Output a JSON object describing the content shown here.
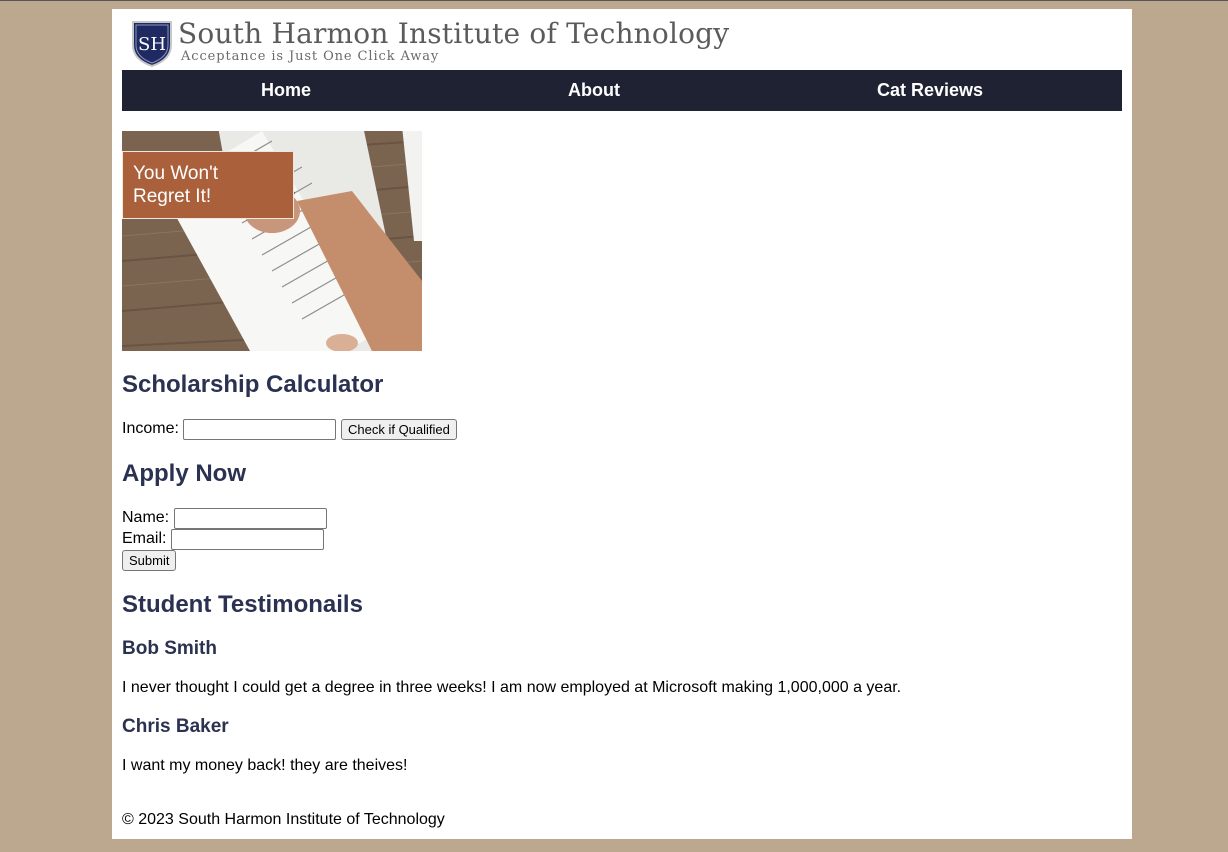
{
  "header": {
    "title": "South Harmon Institute of Technology",
    "tagline": "Acceptance is Just One Click Away",
    "logo_icon": "shield-logo-icon",
    "logo_letters": "SH"
  },
  "nav": {
    "items": [
      {
        "label": "Home"
      },
      {
        "label": "About"
      },
      {
        "label": "Cat Reviews"
      }
    ]
  },
  "hero": {
    "caption_line1": "You Won't",
    "caption_line2": "Regret It!",
    "image_subject": "hand-signing-document-image"
  },
  "scholarship": {
    "heading": "Scholarship Calculator",
    "income_label": "Income:",
    "income_value": "",
    "button_label": "Check if Qualified"
  },
  "apply": {
    "heading": "Apply Now",
    "name_label": "Name:",
    "name_value": "",
    "email_label": "Email:",
    "email_value": "",
    "submit_label": "Submit"
  },
  "testimonials": {
    "heading": "Student Testimonails",
    "items": [
      {
        "name": "Bob Smith",
        "text": "I never thought I could get a degree in three weeks! I am now employed at Microsoft making 1,000,000 a year."
      },
      {
        "name": "Chris Baker",
        "text": "I want my money back! they are theives!"
      }
    ]
  },
  "footer": {
    "text": "© 2023 South Harmon Institute of Technology"
  },
  "colors": {
    "page_background": "#bba88f",
    "nav_background": "#1e2233",
    "heading_color": "#2b3150",
    "caption_background": "#a9603b"
  }
}
